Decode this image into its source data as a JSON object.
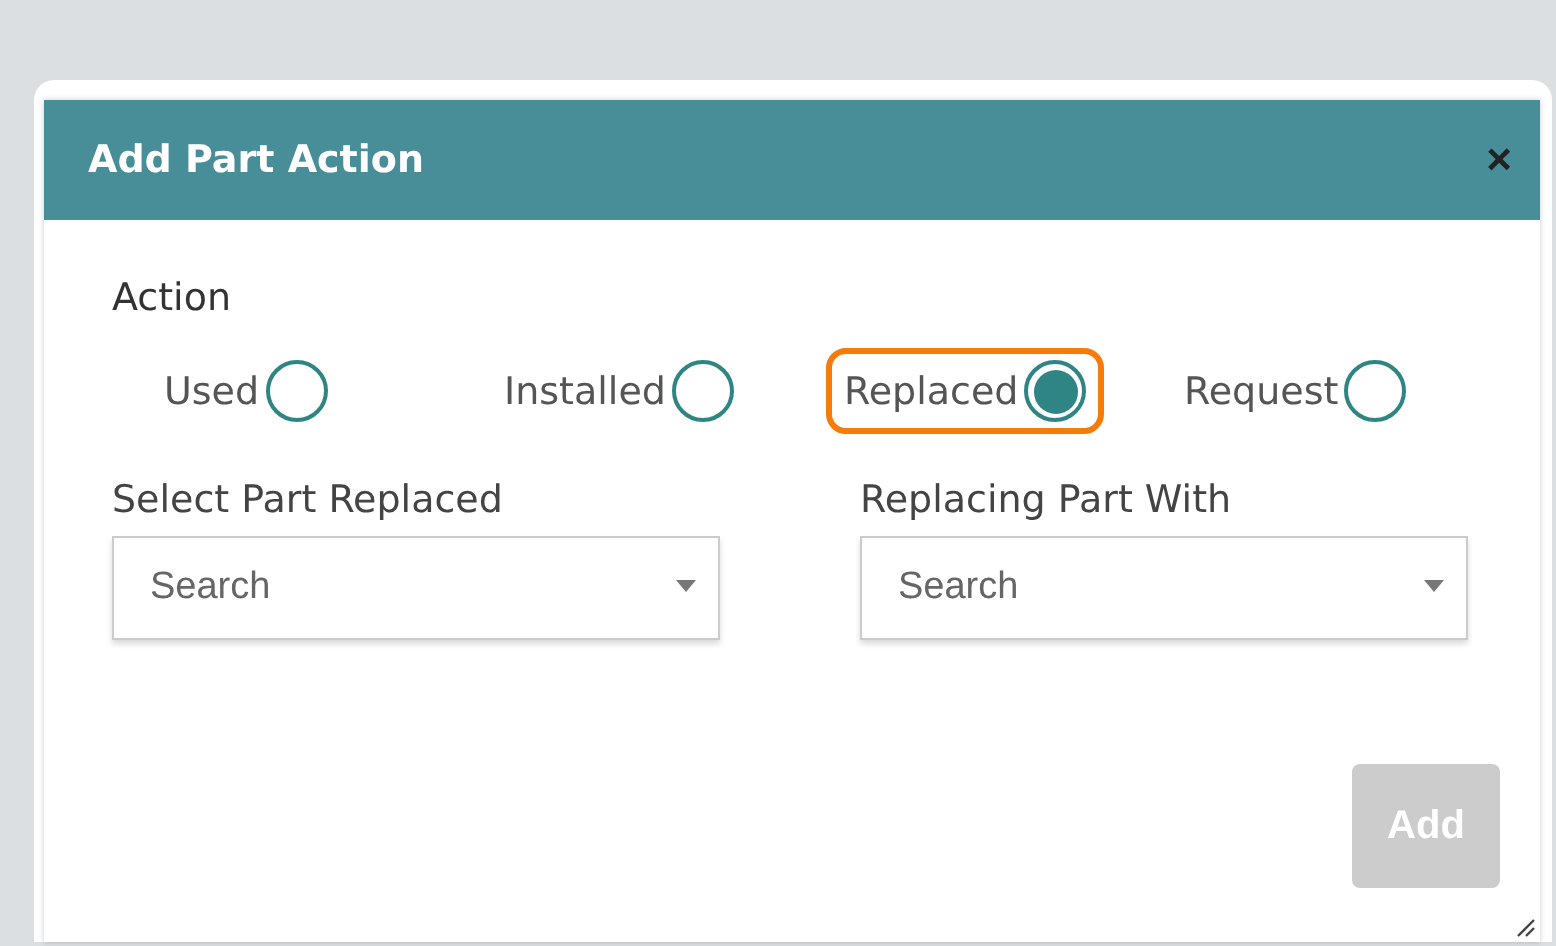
{
  "dialog": {
    "title": "Add Part Action",
    "close": "×",
    "action_label": "Action",
    "options": [
      {
        "label": "Used",
        "selected": false,
        "highlighted": false
      },
      {
        "label": "Installed",
        "selected": false,
        "highlighted": false
      },
      {
        "label": "Replaced",
        "selected": true,
        "highlighted": true
      },
      {
        "label": "Request",
        "selected": false,
        "highlighted": false
      }
    ],
    "fields": [
      {
        "label": "Select Part Replaced",
        "placeholder": "Search"
      },
      {
        "label": "Replacing Part With",
        "placeholder": "Search"
      }
    ],
    "add_button": {
      "label": "Add",
      "disabled": true
    }
  }
}
